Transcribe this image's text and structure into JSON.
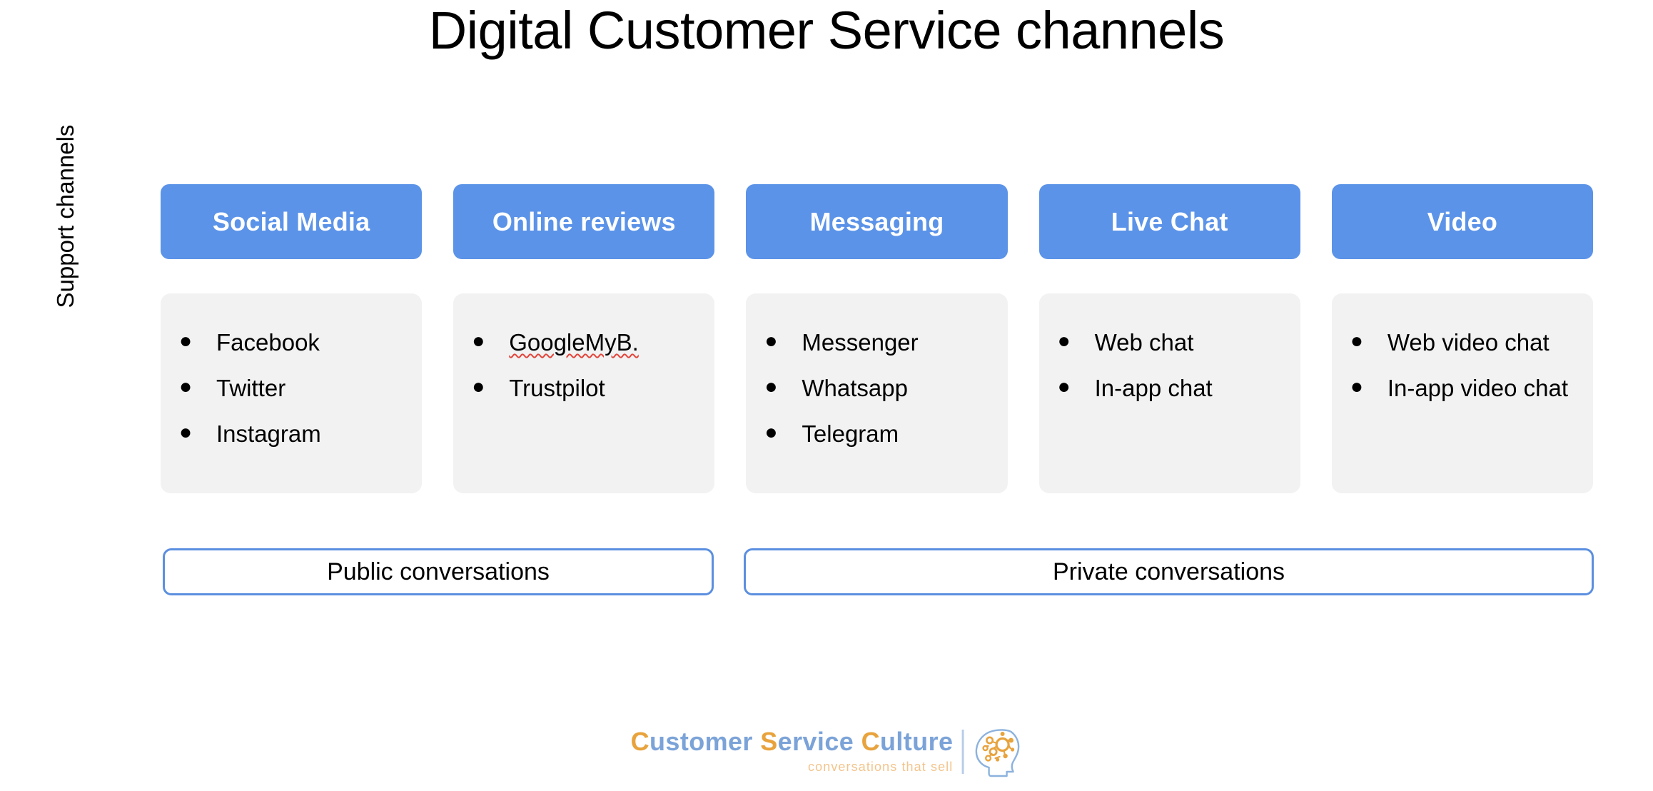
{
  "slide": {
    "title": "Digital Customer Service channels",
    "axis_label": "Support channels"
  },
  "colors": {
    "header_blue": "#5B93E8",
    "card_gray": "#F2F2F2",
    "bar_border_blue": "#5B8FE0",
    "logo_orange": "#E8A33D",
    "logo_blue": "#7BA3D8",
    "spellcheck_red": "#E2453B"
  },
  "columns": [
    {
      "header": "Social Media",
      "items": [
        {
          "label": "Facebook",
          "misspelled": false
        },
        {
          "label": "Twitter",
          "misspelled": false
        },
        {
          "label": "Instagram",
          "misspelled": false
        }
      ]
    },
    {
      "header": "Online reviews",
      "items": [
        {
          "label": "GoogleMyB.",
          "misspelled": true
        },
        {
          "label": "Trustpilot",
          "misspelled": false
        }
      ]
    },
    {
      "header": "Messaging",
      "items": [
        {
          "label": "Messenger",
          "misspelled": false
        },
        {
          "label": "Whatsapp",
          "misspelled": false
        },
        {
          "label": "Telegram",
          "misspelled": false
        }
      ]
    },
    {
      "header": "Live Chat",
      "items": [
        {
          "label": "Web chat",
          "misspelled": false
        },
        {
          "label": "In-app chat",
          "misspelled": false
        }
      ]
    },
    {
      "header": "Video",
      "items": [
        {
          "label": "Web video chat",
          "misspelled": false
        },
        {
          "label": "In-app video chat",
          "misspelled": false
        }
      ]
    }
  ],
  "bullet_glyph": "●",
  "conversation_bars": [
    {
      "label": "Public conversations"
    },
    {
      "label": "Private conversations"
    }
  ],
  "logo": {
    "word1_cap": "C",
    "word1_rest": "ustomer",
    "word2_cap": "S",
    "word2_rest": "ervice",
    "word3_cap": "C",
    "word3_rest": "ulture",
    "tagline": "conversations that sell",
    "mark_name": "head-brain-network-icon"
  }
}
